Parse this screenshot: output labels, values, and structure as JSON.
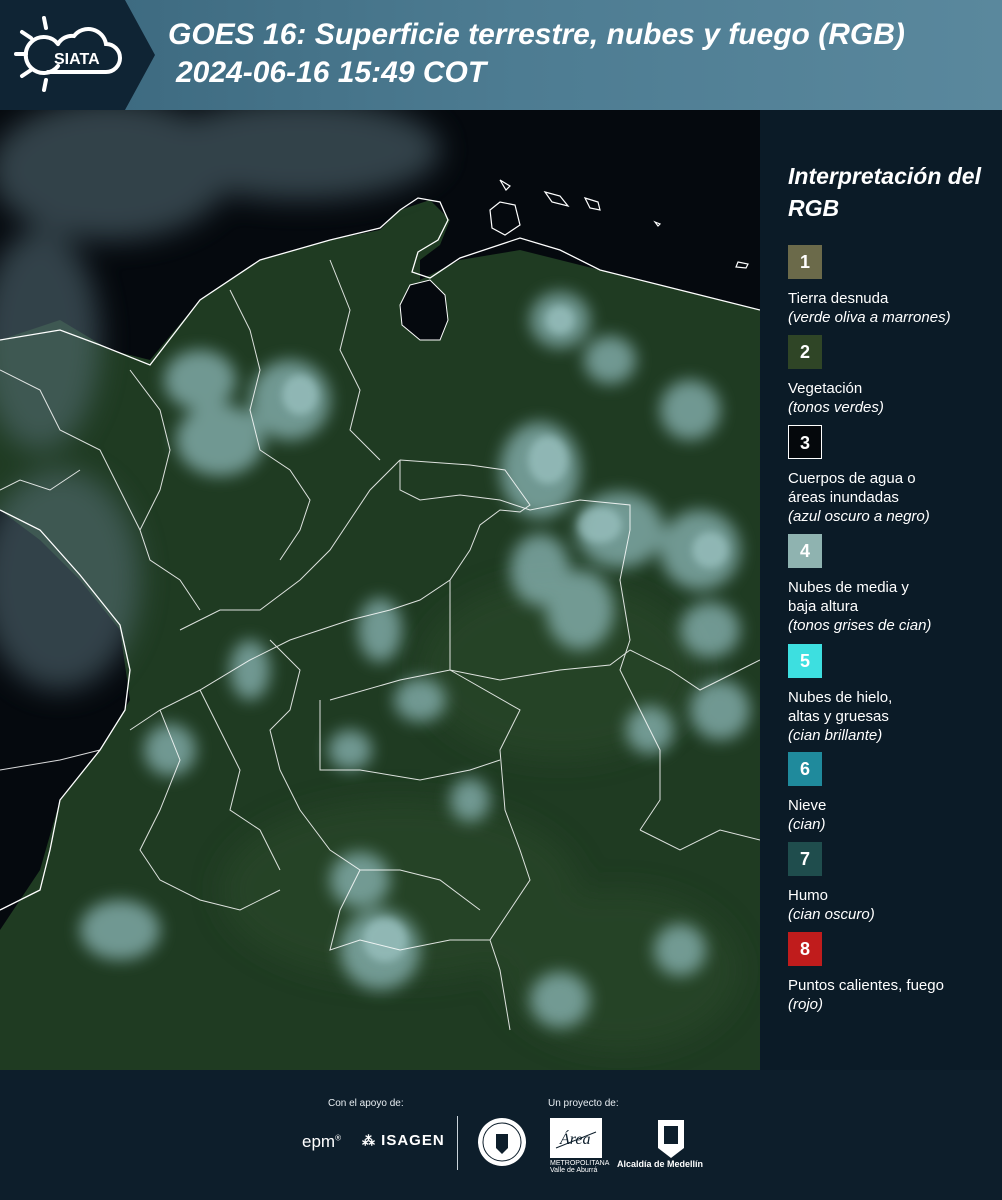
{
  "header": {
    "logo_text": "SIATA",
    "title": "GOES 16: Superficie terrestre, nubes y fuego (RGB)",
    "subtitle": "2024-06-16 15:49 COT"
  },
  "legend": {
    "title": "Interpretación del RGB",
    "items": [
      {
        "num": "1",
        "name": "Tierra desnuda",
        "hint": "(verde oliva a marrones)",
        "color": "#6b6a4a"
      },
      {
        "num": "2",
        "name": "Vegetación",
        "hint": "(tonos verdes)",
        "color": "#2f4526"
      },
      {
        "num": "3",
        "name": "Cuerpos de agua o áreas inundadas",
        "hint": "(azul oscuro a negro)",
        "color": "#05080c"
      },
      {
        "num": "4",
        "name": "Nubes de media y baja altura",
        "hint": "(tonos grises de cian)",
        "color": "#8fb3b0"
      },
      {
        "num": "5",
        "name": "Nubes de hielo, altas y gruesas",
        "hint": "(cian brillante)",
        "color": "#3ddfe0"
      },
      {
        "num": "6",
        "name": "Nieve",
        "hint": "(cian)",
        "color": "#1f8a9c"
      },
      {
        "num": "7",
        "name": "Humo",
        "hint": "(cian oscuro)",
        "color": "#1f4d4d"
      },
      {
        "num": "8",
        "name": "Puntos calientes, fuego",
        "hint": "(rojo)",
        "color": "#c01c1c"
      }
    ]
  },
  "map": {
    "land_color": "#1e3a22",
    "ocean_color": "#05080d",
    "cloud_color": "#8fbcbc",
    "border_color": "#ffffff"
  },
  "footer": {
    "support_label": "Con el apoyo de:",
    "project_label": "Un proyecto de:",
    "sponsor_epm": "epm",
    "sponsor_isagen": "ISAGEN",
    "area_metropolitana": "METROPOLITANA Valle de Aburrá",
    "area_word": "Área",
    "alcaldia": "Alcaldía de Medellín"
  }
}
